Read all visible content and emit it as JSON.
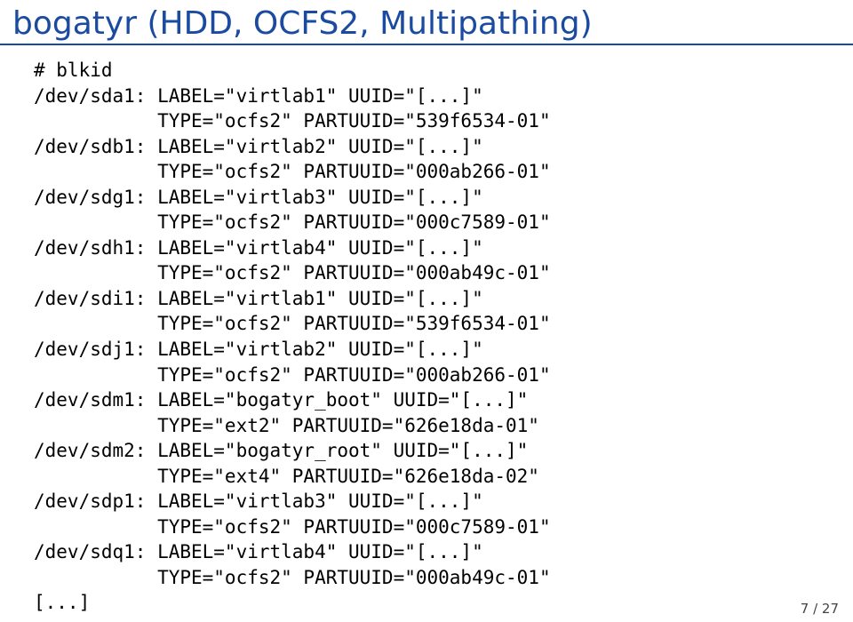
{
  "title": "bogatyr (HDD, OCFS2, Multipathing)",
  "command": "# blkid",
  "lines": [
    "/dev/sda1: LABEL=\"virtlab1\" UUID=\"[...]\"",
    "           TYPE=\"ocfs2\" PARTUUID=\"539f6534-01\"",
    "/dev/sdb1: LABEL=\"virtlab2\" UUID=\"[...]\"",
    "           TYPE=\"ocfs2\" PARTUUID=\"000ab266-01\"",
    "/dev/sdg1: LABEL=\"virtlab3\" UUID=\"[...]\"",
    "           TYPE=\"ocfs2\" PARTUUID=\"000c7589-01\"",
    "/dev/sdh1: LABEL=\"virtlab4\" UUID=\"[...]\"",
    "           TYPE=\"ocfs2\" PARTUUID=\"000ab49c-01\"",
    "/dev/sdi1: LABEL=\"virtlab1\" UUID=\"[...]\"",
    "           TYPE=\"ocfs2\" PARTUUID=\"539f6534-01\"",
    "/dev/sdj1: LABEL=\"virtlab2\" UUID=\"[...]\"",
    "           TYPE=\"ocfs2\" PARTUUID=\"000ab266-01\"",
    "/dev/sdm1: LABEL=\"bogatyr_boot\" UUID=\"[...]\"",
    "           TYPE=\"ext2\" PARTUUID=\"626e18da-01\"",
    "/dev/sdm2: LABEL=\"bogatyr_root\" UUID=\"[...]\"",
    "           TYPE=\"ext4\" PARTUUID=\"626e18da-02\"",
    "/dev/sdp1: LABEL=\"virtlab3\" UUID=\"[...]\"",
    "           TYPE=\"ocfs2\" PARTUUID=\"000c7589-01\"",
    "/dev/sdq1: LABEL=\"virtlab4\" UUID=\"[...]\"",
    "           TYPE=\"ocfs2\" PARTUUID=\"000ab49c-01\""
  ],
  "trailing": "[...]",
  "pager": "7 / 27"
}
